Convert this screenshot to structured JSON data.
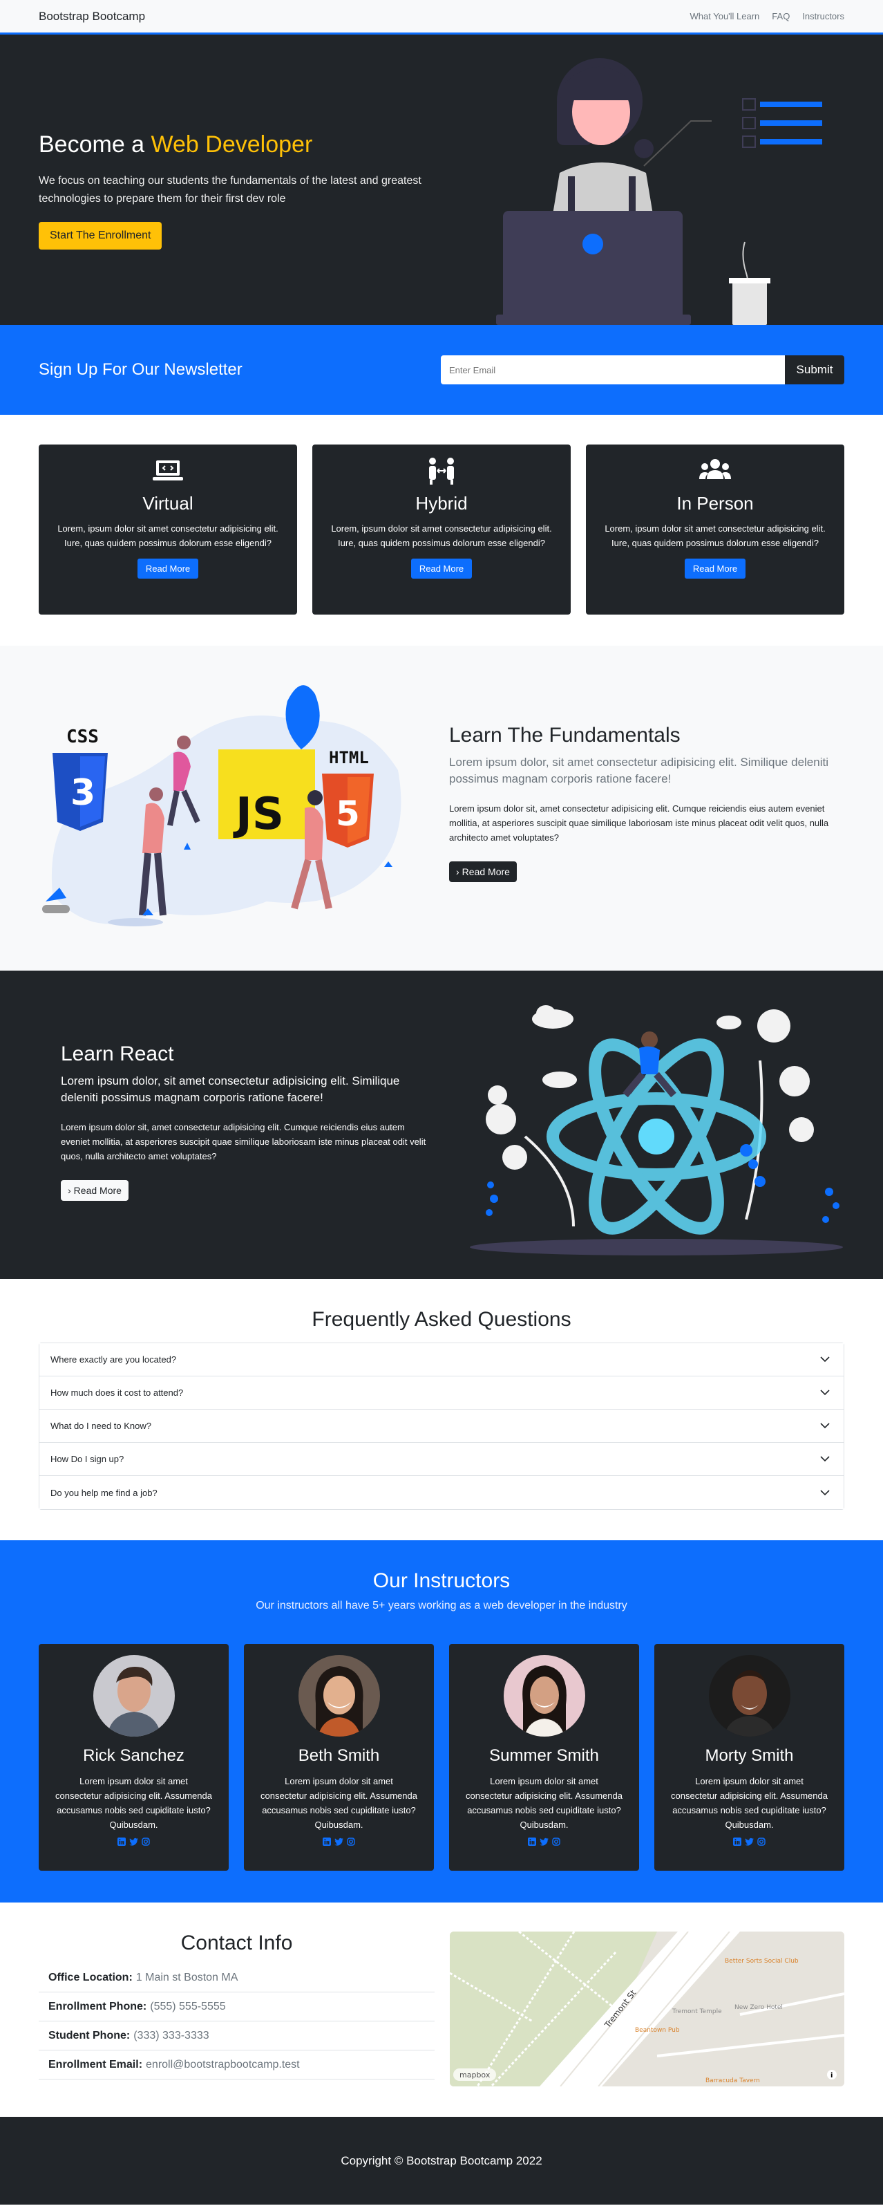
{
  "nav": {
    "brand": "Bootstrap Bootcamp",
    "links": [
      "What You'll Learn",
      "FAQ",
      "Instructors"
    ]
  },
  "hero": {
    "title_prefix": "Become a",
    "title_accent": "Web Developer",
    "description": "We focus on teaching our students the fundamentals of the latest and greatest technologies to prepare them for their first dev role",
    "cta": "Start The Enrollment"
  },
  "newsletter": {
    "heading": "Sign Up For Our Newsletter",
    "placeholder": "Enter Email",
    "submit": "Submit"
  },
  "boxes": [
    {
      "icon": "laptop-code-icon",
      "title": "Virtual",
      "text": "Lorem, ipsum dolor sit amet consectetur adipisicing elit. Iure, quas quidem possimus dolorum esse eligendi?",
      "button": "Read More"
    },
    {
      "icon": "people-arrows-icon",
      "title": "Hybrid",
      "text": "Lorem, ipsum dolor sit amet consectetur adipisicing elit. Iure, quas quidem possimus dolorum esse eligendi?",
      "button": "Read More"
    },
    {
      "icon": "users-icon",
      "title": "In Person",
      "text": "Lorem, ipsum dolor sit amet consectetur adipisicing elit. Iure, quas quidem possimus dolorum esse eligendi?",
      "button": "Read More"
    }
  ],
  "learn_fundamentals": {
    "title": "Learn The Fundamentals",
    "lead": "Lorem ipsum dolor, sit amet consectetur adipisicing elit. Similique deleniti possimus magnam corporis ratione facere!",
    "body": "Lorem ipsum dolor sit, amet consectetur adipisicing elit. Cumque reiciendis eius autem eveniet mollitia, at asperiores suscipit quae similique laboriosam iste minus placeat odit velit quos, nulla architecto amet voluptates?",
    "button": "Read More",
    "illustration_labels": {
      "css": "CSS",
      "js": "JS",
      "html": "HTML"
    }
  },
  "learn_react": {
    "title": "Learn React",
    "lead": "Lorem ipsum dolor, sit amet consectetur adipisicing elit. Similique deleniti possimus magnam corporis ratione facere!",
    "body": "Lorem ipsum dolor sit, amet consectetur adipisicing elit. Cumque reiciendis eius autem eveniet mollitia, at asperiores suscipit quae similique laboriosam iste minus placeat odit velit quos, nulla architecto amet voluptates?",
    "button": "Read More"
  },
  "faq": {
    "title": "Frequently Asked Questions",
    "items": [
      "Where exactly are you located?",
      "How much does it cost to attend?",
      "What do I need to Know?",
      "How Do I sign up?",
      "Do you help me find a job?"
    ]
  },
  "instructors": {
    "title": "Our Instructors",
    "subtitle": "Our instructors all have 5+ years working as a web developer in the industry",
    "people": [
      {
        "name": "Rick Sanchez",
        "bio": "Lorem ipsum dolor sit amet consectetur adipisicing elit. Assumenda accusamus nobis sed cupiditate iusto? Quibusdam."
      },
      {
        "name": "Beth Smith",
        "bio": "Lorem ipsum dolor sit amet consectetur adipisicing elit. Assumenda accusamus nobis sed cupiditate iusto? Quibusdam."
      },
      {
        "name": "Summer Smith",
        "bio": "Lorem ipsum dolor sit amet consectetur adipisicing elit. Assumenda accusamus nobis sed cupiditate iusto? Quibusdam."
      },
      {
        "name": "Morty Smith",
        "bio": "Lorem ipsum dolor sit amet consectetur adipisicing elit. Assumenda accusamus nobis sed cupiditate iusto? Quibusdam."
      }
    ],
    "social_icons": [
      "linkedin-icon",
      "twitter-icon",
      "instagram-icon"
    ]
  },
  "contact": {
    "title": "Contact Info",
    "rows": [
      {
        "label": "Office Location:",
        "value": "1 Main st Boston MA"
      },
      {
        "label": "Enrollment Phone:",
        "value": "(555) 555-5555"
      },
      {
        "label": "Student Phone:",
        "value": "(333) 333-3333"
      },
      {
        "label": "Enrollment Email:",
        "value": "enroll@bootstrapbootcamp.test"
      }
    ],
    "map": {
      "street": "Tremont St",
      "places": [
        "Better Sorts Social Club",
        "Tremont Temple",
        "New Zero Hotel",
        "Beantown Pub",
        "Barracuda Tavern"
      ],
      "attribution": "mapbox"
    }
  },
  "footer": {
    "text": "Copyright © Bootstrap Bootcamp 2022"
  },
  "colors": {
    "primary": "#0d6efd",
    "dark": "#212529",
    "warning": "#ffc107",
    "light": "#f8f9fa"
  }
}
